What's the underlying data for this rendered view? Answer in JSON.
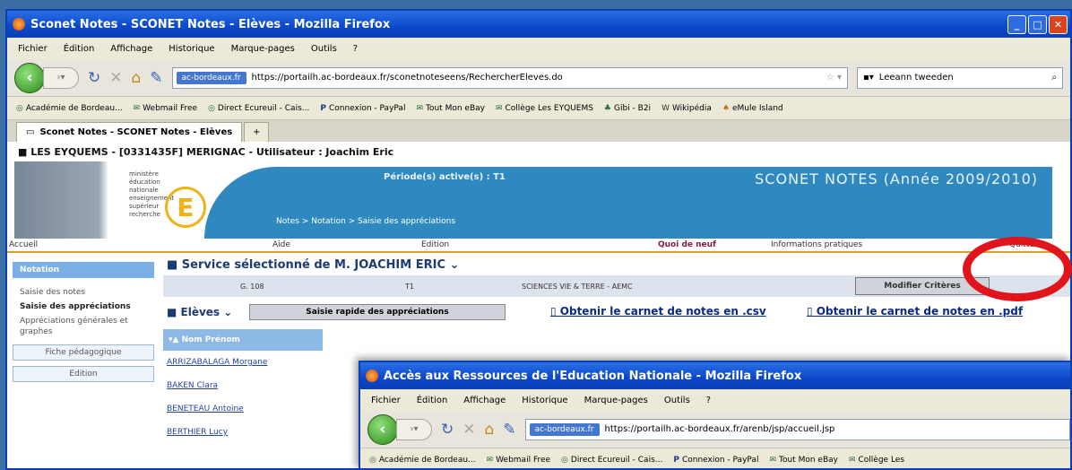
{
  "win1": {
    "title": "Sconet Notes - SCONET Notes - Elèves - Mozilla Firefox",
    "menu": [
      "Fichier",
      "Édition",
      "Affichage",
      "Historique",
      "Marque-pages",
      "Outils",
      "?"
    ],
    "site_id": "ac-bordeaux.fr",
    "url": "https://portailh.ac-bordeaux.fr/sconetnoteseens/RechercherEleves.do",
    "search": "Leeann tweeden",
    "bookmarks": [
      "Académie de Bordeau...",
      "Webmail Free",
      "Direct Ecureuil - Cais...",
      "Connexion - PayPal",
      "Tout Mon eBay",
      "Collège Les EYQUEMS",
      "Gibi - B2i",
      "Wikipédia",
      "eMule Island"
    ],
    "tab": "Sconet Notes - SCONET Notes - Elèves",
    "tab_plus": "+",
    "headline": "■ LES EYQUEMS - [0331435F] MERIGNAC - Utilisateur : Joachim Eric",
    "logo_lines": [
      "ministère",
      "éducation",
      "nationale",
      "enseignement",
      "supérieur",
      "recherche"
    ],
    "logo_letter": "E",
    "periode": "Période(s) active(s) : T1",
    "app_title": "SCONET NOTES (Année 2009/2010)",
    "crumb": "Notes > Notation > Saisie des appréciations",
    "topnav": [
      "Accueil",
      "Aide",
      "Edition",
      "Quoi de neuf",
      "Informations pratiques",
      "Quitter"
    ],
    "side": {
      "head": "Notation",
      "items": [
        "Saisie des notes",
        "Saisie des appréciations",
        "Appréciations générales et graphes"
      ],
      "boxes": [
        "Fiche pédagogique",
        "Edition"
      ]
    },
    "service": "■ Service sélectionné de M. JOACHIM ERIC ⌄",
    "svc_row": [
      "G. 108",
      "T1",
      "SCIENCES VIE & TERRE - AEMC"
    ],
    "modif_btn": "Modifier Critères",
    "eleves": "■ Elèves ⌄",
    "saisie_btn": "Saisie rapide des appréciations",
    "link_csv": "Obtenir le carnet de notes en .csv",
    "link_pdf": "Obtenir le carnet de notes en .pdf",
    "nom_hdr": "▾▲ Nom Prénom",
    "students": [
      "ARRIZABALAGA Morgane",
      "BAKEN Clara",
      "BENETEAU Antoine",
      "BERTHIER Lucy"
    ]
  },
  "win2": {
    "title": "Accès aux Ressources de l'Education Nationale - Mozilla Firefox",
    "menu": [
      "Fichier",
      "Édition",
      "Affichage",
      "Historique",
      "Marque-pages",
      "Outils",
      "?"
    ],
    "site_id": "ac-bordeaux.fr",
    "url": "https://portailh.ac-bordeaux.fr/arenb/jsp/accueil.jsp",
    "bookmarks": [
      "Académie de Bordeau...",
      "Webmail Free",
      "Direct Ecureuil - Cais...",
      "Connexion - PayPal",
      "Tout Mon eBay",
      "Collège Les"
    ]
  },
  "colors": {
    "titlebar": "#0a47c9",
    "banner": "#2f89c0",
    "highlight_ring": "#e0141a",
    "accent_nav": "#e0a020"
  }
}
